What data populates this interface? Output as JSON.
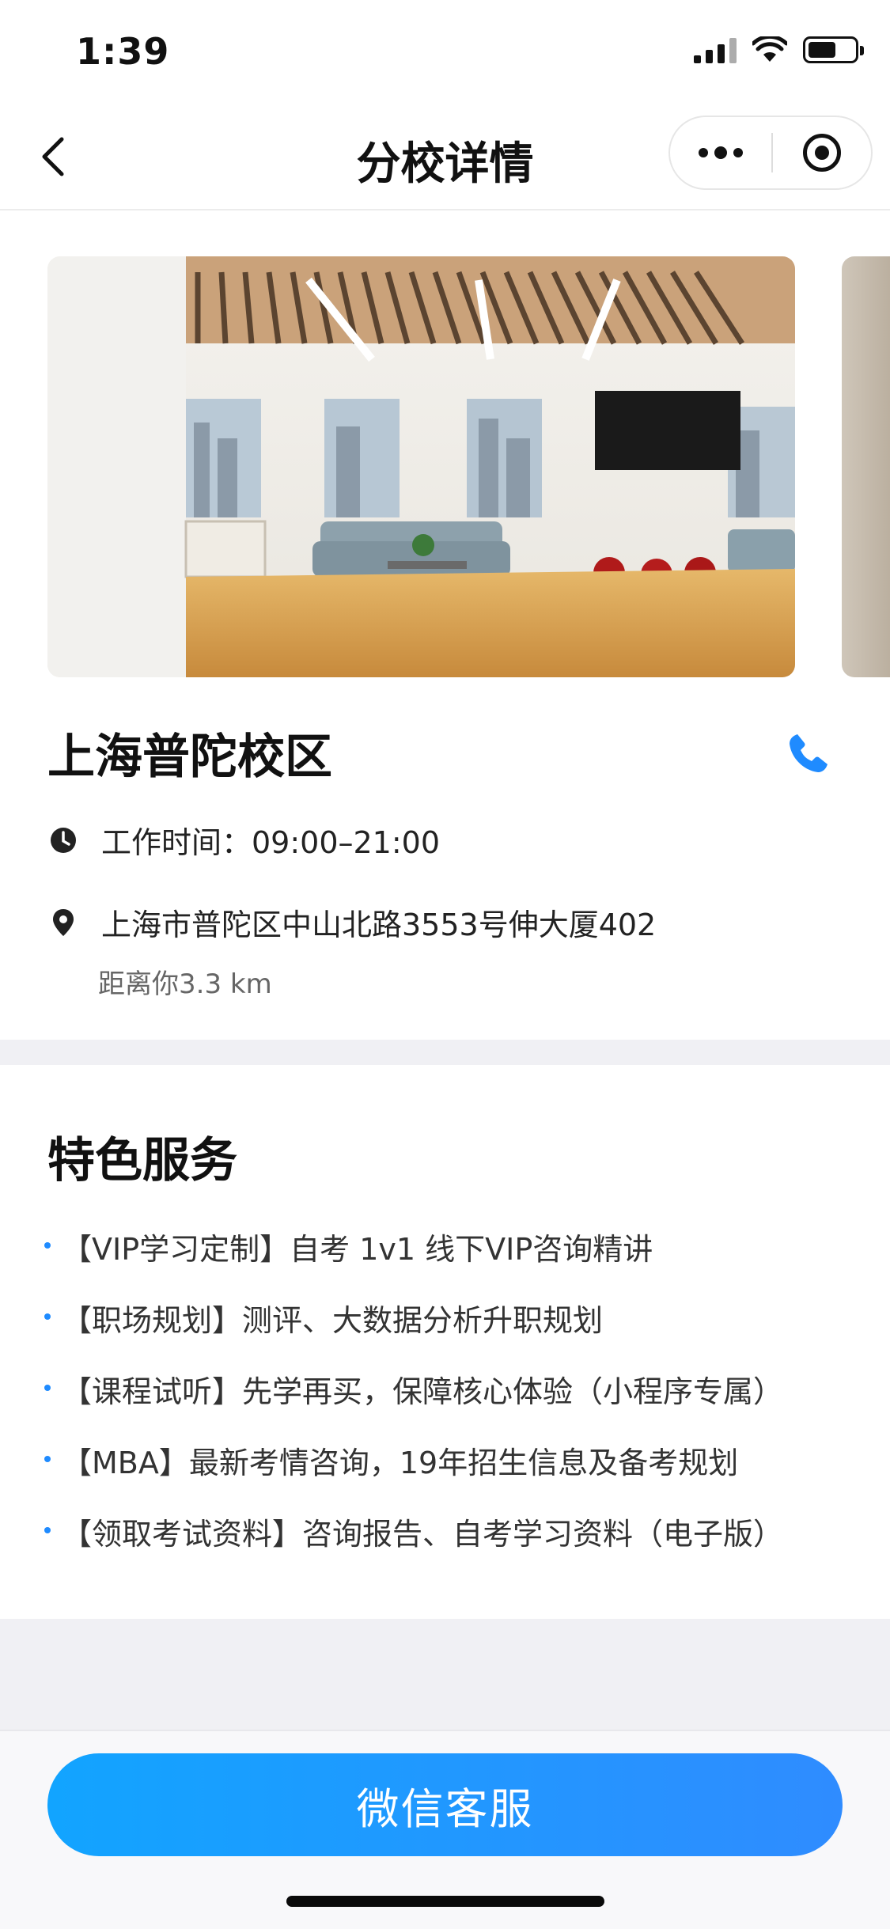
{
  "status_bar": {
    "time": "1:39"
  },
  "nav": {
    "title": "分校详情"
  },
  "campus": {
    "name": "上海普陀校区",
    "hours": "工作时间：09:00–21:00",
    "address": "上海市普陀区中山北路3553号伸大厦402",
    "distance": "距离你3.3 km"
  },
  "services": {
    "title": "特色服务",
    "items": [
      "【VIP学习定制】自考 1v1 线下VIP咨询精讲",
      "【职场规划】测评、大数据分析升职规划",
      "【课程试听】先学再买，保障核心体验（小程序专属）",
      "【MBA】最新考情咨询，19年招生信息及备考规划",
      "【领取考试资料】咨询报告、自考学习资料（电子版）"
    ]
  },
  "footer": {
    "button_label": "微信客服"
  },
  "colors": {
    "accent": "#1f8bff",
    "button_start": "#12a4ff",
    "button_end": "#2f8cff",
    "band": "#f0f0f4"
  }
}
